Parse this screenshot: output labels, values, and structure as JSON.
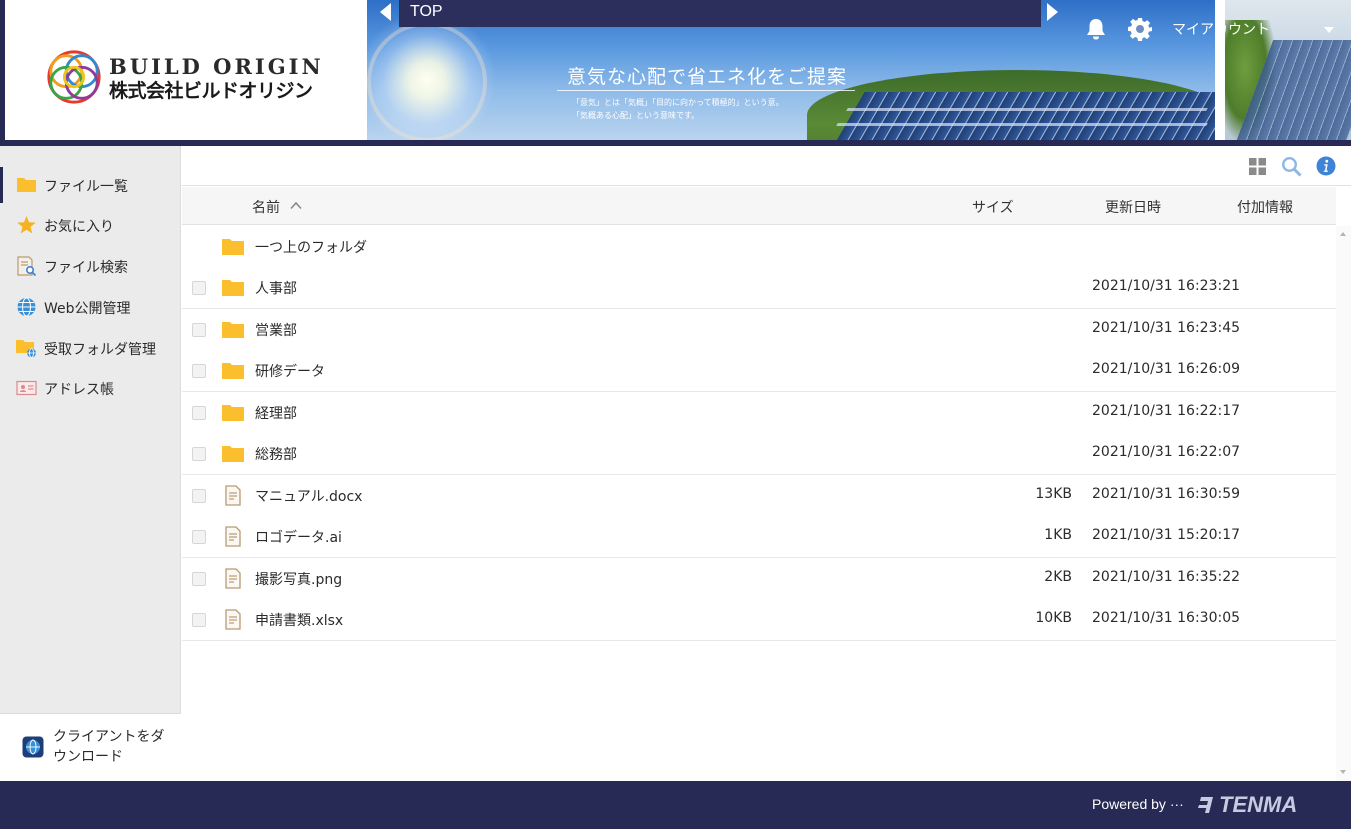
{
  "header": {
    "logo_en": "BUILD ORIGIN",
    "logo_jp": "株式会社ビルドオリジン",
    "banner_title": "意気な心配で省エネ化をご提案",
    "banner_sub1": "「意気」とは「気概」「目的に向かって積極的」という意。",
    "banner_sub2": "「気概ある心配」という意味です。",
    "top_bar_label": "TOP",
    "account_label": "マイアカウント",
    "bell_icon": "bell-icon",
    "gear_icon": "gear-icon"
  },
  "sidebar": {
    "items": [
      {
        "label": "ファイル一覧",
        "icon": "folder-icon"
      },
      {
        "label": "お気に入り",
        "icon": "star-icon"
      },
      {
        "label": "ファイル検索",
        "icon": "file-search-icon"
      },
      {
        "label": "Web公開管理",
        "icon": "globe-icon"
      },
      {
        "label": "受取フォルダ管理",
        "icon": "receive-folder-icon"
      },
      {
        "label": "アドレス帳",
        "icon": "address-book-icon"
      }
    ],
    "download_label": "クライアントをダウンロード"
  },
  "table": {
    "columns": {
      "name": "名前",
      "size": "サイズ",
      "date": "更新日時",
      "extra": "付加情報"
    },
    "parent_folder": "一つ上のフォルダ",
    "rows": [
      {
        "name": "人事部",
        "type": "folder",
        "size": "",
        "date": "2021/10/31 16:23:21"
      },
      {
        "name": "営業部",
        "type": "folder",
        "size": "",
        "date": "2021/10/31 16:23:45"
      },
      {
        "name": "研修データ",
        "type": "folder",
        "size": "",
        "date": "2021/10/31 16:26:09"
      },
      {
        "name": "経理部",
        "type": "folder",
        "size": "",
        "date": "2021/10/31 16:22:17"
      },
      {
        "name": "総務部",
        "type": "folder",
        "size": "",
        "date": "2021/10/31 16:22:07"
      },
      {
        "name": "マニュアル.docx",
        "type": "file",
        "size": "13KB",
        "date": "2021/10/31 16:30:59"
      },
      {
        "name": "ロゴデータ.ai",
        "type": "file",
        "size": "1KB",
        "date": "2021/10/31 15:20:17"
      },
      {
        "name": "撮影写真.png",
        "type": "file",
        "size": "2KB",
        "date": "2021/10/31 16:35:22"
      },
      {
        "name": "申請書類.xlsx",
        "type": "file",
        "size": "10KB",
        "date": "2021/10/31 16:30:05"
      }
    ]
  },
  "footer": {
    "powered_by": "Powered by ···",
    "brand": "TENMA"
  },
  "colors": {
    "navy": "#272a55",
    "folder": "#fbbf2d",
    "accent_blue": "#3f83d6"
  }
}
